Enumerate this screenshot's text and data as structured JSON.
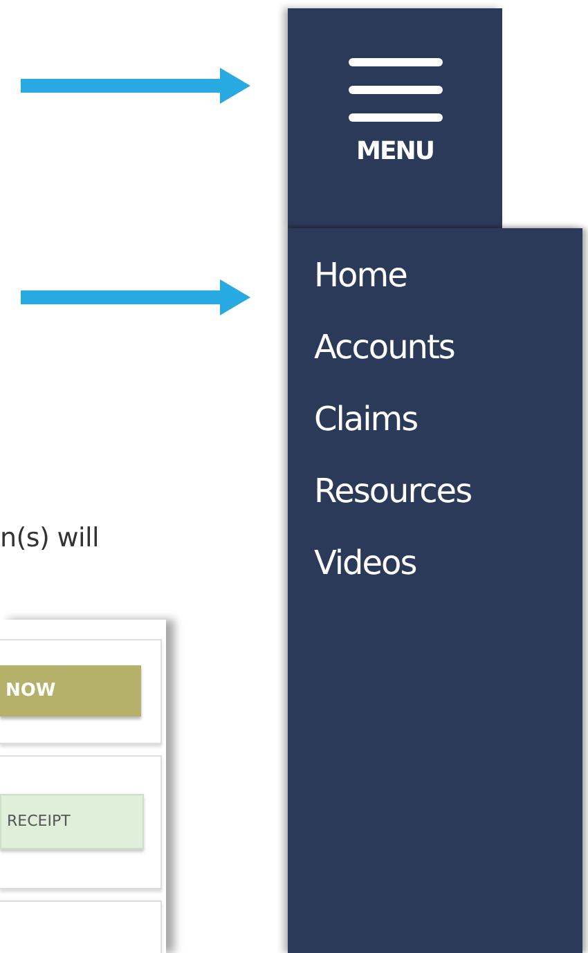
{
  "menu_button": {
    "label": "MENU"
  },
  "menu_items": [
    {
      "label": "Home"
    },
    {
      "label": "Accounts"
    },
    {
      "label": "Claims"
    },
    {
      "label": "Resources"
    },
    {
      "label": "Videos"
    }
  ],
  "document": {
    "text": "n(s) will",
    "inner_screenshot": {
      "buttons": [
        {
          "label": "NOW",
          "kind": "primary"
        },
        {
          "label": "RECEIPT",
          "kind": "secondary"
        }
      ]
    }
  }
}
